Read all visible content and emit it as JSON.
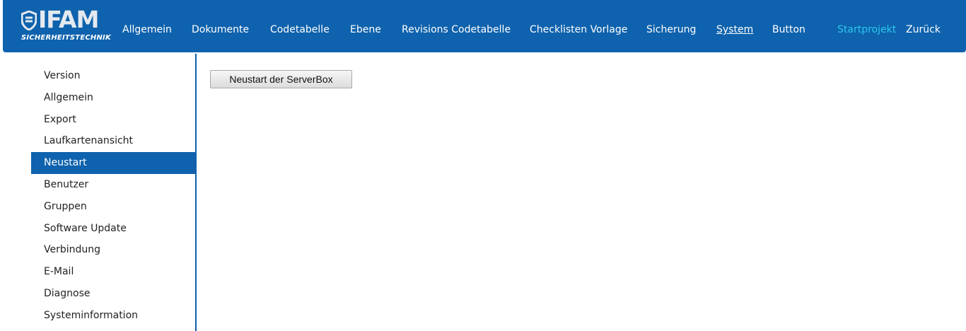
{
  "logo": {
    "word": "IFAM",
    "subtitle": "SICHERHEITSTECHNIK"
  },
  "nav": {
    "items": [
      "Allgemein",
      "Dokumente",
      "Codetabelle",
      "Ebene",
      "Revisions Codetabelle",
      "Checklisten Vorlage",
      "Sicherung",
      "System",
      "Button"
    ],
    "active": "System",
    "startprojekt": "Startprojekt",
    "zurueck": "Zurück"
  },
  "sidebar": {
    "items": [
      "Version",
      "Allgemein",
      "Export",
      "Laufkartenansicht",
      "Neustart",
      "Benutzer",
      "Gruppen",
      "Software Update",
      "Verbindung",
      "E-Mail",
      "Diagnose",
      "Systeminformation"
    ],
    "active": "Neustart"
  },
  "main": {
    "restart_button": "Neustart der ServerBox"
  },
  "colors": {
    "brand": "#0f62ad",
    "highlight": "#29c8ef"
  }
}
